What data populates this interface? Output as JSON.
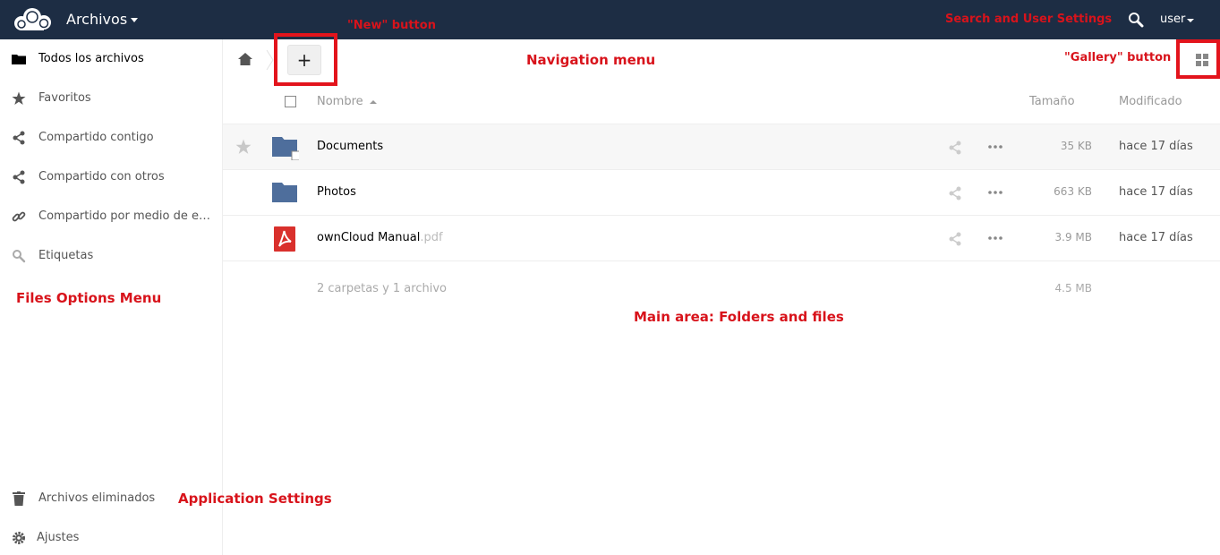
{
  "header": {
    "app_title": "Archivos",
    "user_label": "user",
    "background_color": "#1d2d44"
  },
  "sidebar": {
    "items": [
      {
        "label": "Todos los archivos",
        "icon": "folder-icon",
        "active": true
      },
      {
        "label": "Favoritos",
        "icon": "star-icon"
      },
      {
        "label": "Compartido contigo",
        "icon": "share-icon"
      },
      {
        "label": "Compartido con otros",
        "icon": "share-icon"
      },
      {
        "label": "Compartido por medio de enlaces",
        "icon": "link-icon"
      },
      {
        "label": "Etiquetas",
        "icon": "tag-icon"
      }
    ],
    "bottom_items": [
      {
        "label": "Archivos eliminados",
        "icon": "trash-icon"
      },
      {
        "label": "Ajustes",
        "icon": "gear-icon"
      }
    ]
  },
  "controls": {
    "new_button_label": "+"
  },
  "table": {
    "columns": {
      "name": "Nombre",
      "size": "Tamaño",
      "modified": "Modificado"
    },
    "rows": [
      {
        "name": "Documents",
        "ext": "",
        "type": "folder-shared",
        "size": "35 KB",
        "modified": "hace 17 días"
      },
      {
        "name": "Photos",
        "ext": "",
        "type": "folder",
        "size": "663 KB",
        "modified": "hace 17 días"
      },
      {
        "name": "ownCloud Manual",
        "ext": ".pdf",
        "type": "pdf",
        "size": "3.9 MB",
        "modified": "hace 17 días"
      }
    ],
    "summary": {
      "text": "2 carpetas y 1 archivo",
      "size": "4.5 MB"
    }
  },
  "annotations": {
    "new_button": "\"New\" button",
    "navigation_menu": "Navigation menu",
    "gallery_button": "\"Gallery\" button",
    "search_user_settings": "Search and User Settings",
    "files_options_menu": "Files Options Menu",
    "main_area": "Main area: Folders and files",
    "application_settings": "Application Settings",
    "color": "#d8131b"
  }
}
